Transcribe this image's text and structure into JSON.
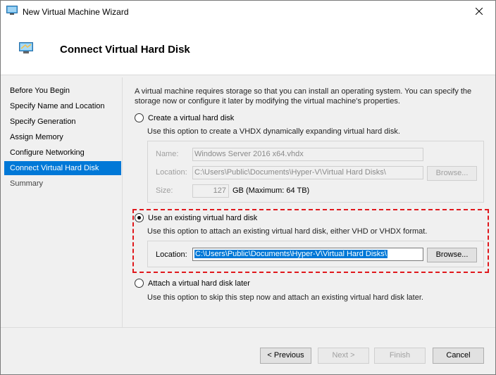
{
  "window": {
    "title": "New Virtual Machine Wizard",
    "header_title": "Connect Virtual Hard Disk"
  },
  "nav": {
    "items": [
      {
        "label": "Before You Begin"
      },
      {
        "label": "Specify Name and Location"
      },
      {
        "label": "Specify Generation"
      },
      {
        "label": "Assign Memory"
      },
      {
        "label": "Configure Networking"
      },
      {
        "label": "Connect Virtual Hard Disk"
      },
      {
        "label": "Summary"
      }
    ],
    "active_index": 5
  },
  "content": {
    "description": "A virtual machine requires storage so that you can install an operating system. You can specify the storage now or configure it later by modifying the virtual machine's properties.",
    "create": {
      "label": "Create a virtual hard disk",
      "description": "Use this option to create a VHDX dynamically expanding virtual hard disk.",
      "name_label": "Name:",
      "name_value": "Windows Server 2016 x64.vhdx",
      "location_label": "Location:",
      "location_value": "C:\\Users\\Public\\Documents\\Hyper-V\\Virtual Hard Disks\\",
      "browse_label": "Browse...",
      "size_label": "Size:",
      "size_value": "127",
      "size_suffix": "GB (Maximum: 64 TB)",
      "selected": false
    },
    "existing": {
      "label": "Use an existing virtual hard disk",
      "description": "Use this option to attach an existing virtual hard disk, either VHD or VHDX format.",
      "location_label": "Location:",
      "location_value": "C:\\Users\\Public\\Documents\\Hyper-V\\Virtual Hard Disks\\",
      "browse_label": "Browse...",
      "selected": true
    },
    "later": {
      "label": "Attach a virtual hard disk later",
      "description": "Use this option to skip this step now and attach an existing virtual hard disk later.",
      "selected": false
    }
  },
  "footer": {
    "previous_label": "< Previous",
    "next_label": "Next >",
    "finish_label": "Finish",
    "cancel_label": "Cancel"
  },
  "colors": {
    "accent": "#0078d7",
    "highlight": "#e0181c"
  }
}
